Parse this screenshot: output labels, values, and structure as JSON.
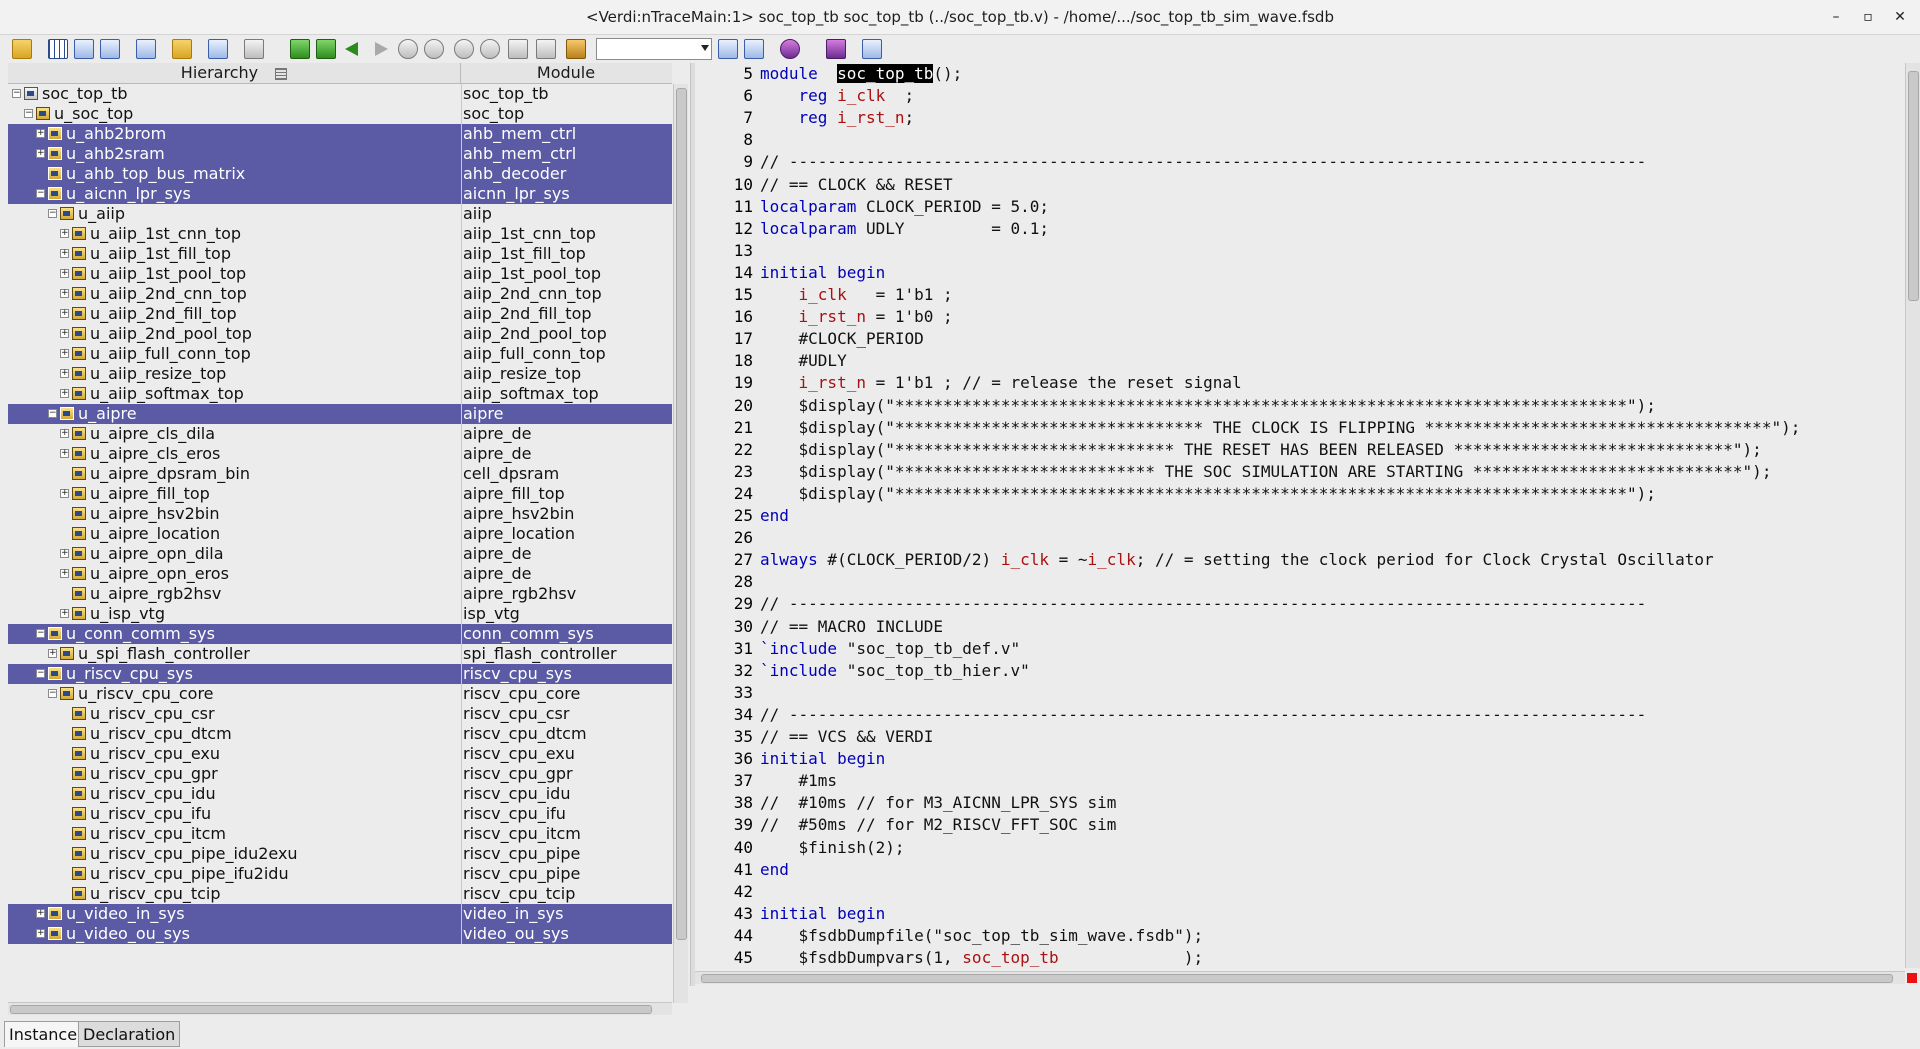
{
  "window": {
    "title": "<Verdi:nTraceMain:1> soc_top_tb soc_top_tb (../soc_top_tb.v) - /home/.../soc_top_tb_sim_wave.fsdb",
    "minimize": "–",
    "restore": "▫",
    "close": "✕"
  },
  "toolbar": {
    "combo_value": ""
  },
  "hierarchy": {
    "col_instance": "Hierarchy",
    "col_module": "Module",
    "rows": [
      {
        "name": "soc_top_tb",
        "module": "soc_top_tb",
        "level": 0,
        "expander": "-",
        "selected": false,
        "icon": "top"
      },
      {
        "name": "u_soc_top",
        "module": "soc_top",
        "level": 1,
        "expander": "-",
        "selected": false,
        "icon": "module"
      },
      {
        "name": "u_ahb2brom",
        "module": "ahb_mem_ctrl",
        "level": 2,
        "expander": "+",
        "selected": true,
        "icon": "module"
      },
      {
        "name": "u_ahb2sram",
        "module": "ahb_mem_ctrl",
        "level": 2,
        "expander": "+",
        "selected": true,
        "icon": "module"
      },
      {
        "name": "u_ahb_top_bus_matrix",
        "module": "ahb_decoder",
        "level": 2,
        "expander": "",
        "selected": true,
        "icon": "module"
      },
      {
        "name": "u_aicnn_lpr_sys",
        "module": "aicnn_lpr_sys",
        "level": 2,
        "expander": "-",
        "selected": true,
        "icon": "module"
      },
      {
        "name": "u_aiip",
        "module": "aiip",
        "level": 3,
        "expander": "-",
        "selected": false,
        "icon": "module"
      },
      {
        "name": "u_aiip_1st_cnn_top",
        "module": "aiip_1st_cnn_top",
        "level": 4,
        "expander": "+",
        "selected": false,
        "icon": "module"
      },
      {
        "name": "u_aiip_1st_fill_top",
        "module": "aiip_1st_fill_top",
        "level": 4,
        "expander": "+",
        "selected": false,
        "icon": "module"
      },
      {
        "name": "u_aiip_1st_pool_top",
        "module": "aiip_1st_pool_top",
        "level": 4,
        "expander": "+",
        "selected": false,
        "icon": "module"
      },
      {
        "name": "u_aiip_2nd_cnn_top",
        "module": "aiip_2nd_cnn_top",
        "level": 4,
        "expander": "+",
        "selected": false,
        "icon": "module"
      },
      {
        "name": "u_aiip_2nd_fill_top",
        "module": "aiip_2nd_fill_top",
        "level": 4,
        "expander": "+",
        "selected": false,
        "icon": "module"
      },
      {
        "name": "u_aiip_2nd_pool_top",
        "module": "aiip_2nd_pool_top",
        "level": 4,
        "expander": "+",
        "selected": false,
        "icon": "module"
      },
      {
        "name": "u_aiip_full_conn_top",
        "module": "aiip_full_conn_top",
        "level": 4,
        "expander": "+",
        "selected": false,
        "icon": "module"
      },
      {
        "name": "u_aiip_resize_top",
        "module": "aiip_resize_top",
        "level": 4,
        "expander": "+",
        "selected": false,
        "icon": "module"
      },
      {
        "name": "u_aiip_softmax_top",
        "module": "aiip_softmax_top",
        "level": 4,
        "expander": "+",
        "selected": false,
        "icon": "module"
      },
      {
        "name": "u_aipre",
        "module": "aipre",
        "level": 3,
        "expander": "-",
        "selected": true,
        "icon": "module"
      },
      {
        "name": "u_aipre_cls_dila",
        "module": "aipre_de",
        "level": 4,
        "expander": "+",
        "selected": false,
        "icon": "module"
      },
      {
        "name": "u_aipre_cls_eros",
        "module": "aipre_de",
        "level": 4,
        "expander": "+",
        "selected": false,
        "icon": "module"
      },
      {
        "name": "u_aipre_dpsram_bin",
        "module": "cell_dpsram",
        "level": 4,
        "expander": "",
        "selected": false,
        "icon": "module"
      },
      {
        "name": "u_aipre_fill_top",
        "module": "aipre_fill_top",
        "level": 4,
        "expander": "+",
        "selected": false,
        "icon": "module"
      },
      {
        "name": "u_aipre_hsv2bin",
        "module": "aipre_hsv2bin",
        "level": 4,
        "expander": "",
        "selected": false,
        "icon": "module"
      },
      {
        "name": "u_aipre_location",
        "module": "aipre_location",
        "level": 4,
        "expander": "",
        "selected": false,
        "icon": "module"
      },
      {
        "name": "u_aipre_opn_dila",
        "module": "aipre_de",
        "level": 4,
        "expander": "+",
        "selected": false,
        "icon": "module"
      },
      {
        "name": "u_aipre_opn_eros",
        "module": "aipre_de",
        "level": 4,
        "expander": "+",
        "selected": false,
        "icon": "module"
      },
      {
        "name": "u_aipre_rgb2hsv",
        "module": "aipre_rgb2hsv",
        "level": 4,
        "expander": "",
        "selected": false,
        "icon": "module"
      },
      {
        "name": "u_isp_vtg",
        "module": "isp_vtg",
        "level": 4,
        "expander": "+",
        "selected": false,
        "icon": "module"
      },
      {
        "name": "u_conn_comm_sys",
        "module": "conn_comm_sys",
        "level": 2,
        "expander": "-",
        "selected": true,
        "icon": "module"
      },
      {
        "name": "u_spi_flash_controller",
        "module": "spi_flash_controller",
        "level": 3,
        "expander": "+",
        "selected": false,
        "icon": "module"
      },
      {
        "name": "u_riscv_cpu_sys",
        "module": "riscv_cpu_sys",
        "level": 2,
        "expander": "-",
        "selected": true,
        "icon": "module"
      },
      {
        "name": "u_riscv_cpu_core",
        "module": "riscv_cpu_core",
        "level": 3,
        "expander": "-",
        "selected": false,
        "icon": "module"
      },
      {
        "name": "u_riscv_cpu_csr",
        "module": "riscv_cpu_csr",
        "level": 4,
        "expander": "",
        "selected": false,
        "icon": "module"
      },
      {
        "name": "u_riscv_cpu_dtcm",
        "module": "riscv_cpu_dtcm",
        "level": 4,
        "expander": "",
        "selected": false,
        "icon": "module"
      },
      {
        "name": "u_riscv_cpu_exu",
        "module": "riscv_cpu_exu",
        "level": 4,
        "expander": "",
        "selected": false,
        "icon": "module"
      },
      {
        "name": "u_riscv_cpu_gpr",
        "module": "riscv_cpu_gpr",
        "level": 4,
        "expander": "",
        "selected": false,
        "icon": "module"
      },
      {
        "name": "u_riscv_cpu_idu",
        "module": "riscv_cpu_idu",
        "level": 4,
        "expander": "",
        "selected": false,
        "icon": "module"
      },
      {
        "name": "u_riscv_cpu_ifu",
        "module": "riscv_cpu_ifu",
        "level": 4,
        "expander": "",
        "selected": false,
        "icon": "module"
      },
      {
        "name": "u_riscv_cpu_itcm",
        "module": "riscv_cpu_itcm",
        "level": 4,
        "expander": "",
        "selected": false,
        "icon": "module"
      },
      {
        "name": "u_riscv_cpu_pipe_idu2exu",
        "module": "riscv_cpu_pipe",
        "level": 4,
        "expander": "",
        "selected": false,
        "icon": "module"
      },
      {
        "name": "u_riscv_cpu_pipe_ifu2idu",
        "module": "riscv_cpu_pipe",
        "level": 4,
        "expander": "",
        "selected": false,
        "icon": "module"
      },
      {
        "name": "u_riscv_cpu_tcip",
        "module": "riscv_cpu_tcip",
        "level": 4,
        "expander": "",
        "selected": false,
        "icon": "module"
      },
      {
        "name": "u_video_in_sys",
        "module": "video_in_sys",
        "level": 2,
        "expander": "+",
        "selected": true,
        "icon": "module"
      },
      {
        "name": "u_video_ou_sys",
        "module": "video_ou_sys",
        "level": 2,
        "expander": "+",
        "selected": true,
        "icon": "module"
      }
    ]
  },
  "tabs": [
    {
      "label": "Instance",
      "active": true
    },
    {
      "label": "Declaration",
      "active": false
    }
  ],
  "source": {
    "lines": [
      {
        "n": "5",
        "segs": [
          [
            "kw",
            "module"
          ],
          [
            "",
            "  "
          ],
          [
            "hl",
            "soc_top_tb"
          ],
          [
            "",
            "();"
          ]
        ]
      },
      {
        "n": "6",
        "segs": [
          [
            "",
            "    "
          ],
          [
            "kw",
            "reg"
          ],
          [
            "",
            " "
          ],
          [
            "sig",
            "i_clk"
          ],
          [
            "",
            "  ;"
          ]
        ]
      },
      {
        "n": "7",
        "segs": [
          [
            "",
            "    "
          ],
          [
            "kw",
            "reg"
          ],
          [
            "",
            " "
          ],
          [
            "sig",
            "i_rst_n"
          ],
          [
            "",
            ";"
          ]
        ]
      },
      {
        "n": "8",
        "segs": []
      },
      {
        "n": "9",
        "segs": [
          [
            "",
            "// -----------------------------------------------------------------------------------------"
          ]
        ]
      },
      {
        "n": "10",
        "segs": [
          [
            "",
            "// == CLOCK && RESET"
          ]
        ]
      },
      {
        "n": "11",
        "segs": [
          [
            "kw",
            "localparam"
          ],
          [
            "",
            " CLOCK_PERIOD = 5.0;"
          ]
        ]
      },
      {
        "n": "12",
        "segs": [
          [
            "kw",
            "localparam"
          ],
          [
            "",
            " UDLY         = 0.1;"
          ]
        ]
      },
      {
        "n": "13",
        "segs": []
      },
      {
        "n": "14",
        "segs": [
          [
            "kw",
            "initial begin"
          ]
        ]
      },
      {
        "n": "15",
        "segs": [
          [
            "",
            "    "
          ],
          [
            "sig",
            "i_clk"
          ],
          [
            "",
            "   = 1'b1 ;"
          ]
        ]
      },
      {
        "n": "16",
        "segs": [
          [
            "",
            "    "
          ],
          [
            "sig",
            "i_rst_n"
          ],
          [
            "",
            " = 1'b0 ;"
          ]
        ]
      },
      {
        "n": "17",
        "segs": [
          [
            "",
            "    #CLOCK_PERIOD"
          ]
        ]
      },
      {
        "n": "18",
        "segs": [
          [
            "",
            "    #UDLY"
          ]
        ]
      },
      {
        "n": "19",
        "segs": [
          [
            "",
            "    "
          ],
          [
            "sig",
            "i_rst_n"
          ],
          [
            "",
            " = 1'b1 ; // = release the reset signal"
          ]
        ]
      },
      {
        "n": "20",
        "segs": [
          [
            "",
            "    $display(\"****************************************************************************\");"
          ]
        ]
      },
      {
        "n": "21",
        "segs": [
          [
            "",
            "    $display(\"******************************** THE CLOCK IS FLIPPING ************************************\");"
          ]
        ]
      },
      {
        "n": "22",
        "segs": [
          [
            "",
            "    $display(\"***************************** THE RESET HAS BEEN RELEASED *****************************\");"
          ]
        ]
      },
      {
        "n": "23",
        "segs": [
          [
            "",
            "    $display(\"*************************** THE SOC SIMULATION ARE STARTING ****************************\");"
          ]
        ]
      },
      {
        "n": "24",
        "segs": [
          [
            "",
            "    $display(\"****************************************************************************\");"
          ]
        ]
      },
      {
        "n": "25",
        "segs": [
          [
            "kw",
            "end"
          ]
        ]
      },
      {
        "n": "26",
        "segs": []
      },
      {
        "n": "27",
        "segs": [
          [
            "kw",
            "always"
          ],
          [
            "",
            " #(CLOCK_PERIOD/2) "
          ],
          [
            "sig",
            "i_clk"
          ],
          [
            "",
            " = ~"
          ],
          [
            "sig",
            "i_clk"
          ],
          [
            "",
            "; // = setting the clock period for Clock Crystal Oscillator"
          ]
        ]
      },
      {
        "n": "28",
        "segs": []
      },
      {
        "n": "29",
        "segs": [
          [
            "",
            "// -----------------------------------------------------------------------------------------"
          ]
        ]
      },
      {
        "n": "30",
        "segs": [
          [
            "",
            "// == MACRO INCLUDE"
          ]
        ]
      },
      {
        "n": "31",
        "segs": [
          [
            "kw",
            "`include"
          ],
          [
            "",
            " \"soc_top_tb_def.v\""
          ]
        ]
      },
      {
        "n": "32",
        "segs": [
          [
            "kw",
            "`include"
          ],
          [
            "",
            " \"soc_top_tb_hier.v\""
          ]
        ]
      },
      {
        "n": "33",
        "segs": []
      },
      {
        "n": "34",
        "segs": [
          [
            "",
            "// -----------------------------------------------------------------------------------------"
          ]
        ]
      },
      {
        "n": "35",
        "segs": [
          [
            "",
            "// == VCS && VERDI"
          ]
        ]
      },
      {
        "n": "36",
        "segs": [
          [
            "kw",
            "initial begin"
          ]
        ]
      },
      {
        "n": "37",
        "segs": [
          [
            "",
            "    #1ms"
          ]
        ]
      },
      {
        "n": "38",
        "segs": [
          [
            "",
            "//  #10ms // for M3_AICNN_LPR_SYS sim"
          ]
        ]
      },
      {
        "n": "39",
        "segs": [
          [
            "",
            "//  #50ms // for M2_RISCV_FFT_SOC sim"
          ]
        ]
      },
      {
        "n": "40",
        "segs": [
          [
            "",
            "    $finish(2);"
          ]
        ]
      },
      {
        "n": "41",
        "segs": [
          [
            "kw",
            "end"
          ]
        ]
      },
      {
        "n": "42",
        "segs": []
      },
      {
        "n": "43",
        "segs": [
          [
            "kw",
            "initial begin"
          ]
        ]
      },
      {
        "n": "44",
        "segs": [
          [
            "",
            "    $fsdbDumpfile(\"soc_top_tb_sim_wave.fsdb\");"
          ]
        ]
      },
      {
        "n": "45",
        "segs": [
          [
            "",
            "    $fsdbDumpvars(1, "
          ],
          [
            "sig",
            "soc_top_tb"
          ],
          [
            "",
            "             );"
          ]
        ]
      }
    ]
  },
  "icons": {
    "toolbar": [
      "open-folder-icon",
      "signal-list-icon",
      "schematic-icon",
      "hierarchy-tree-icon",
      "new-window-icon",
      "folder-icon",
      "edit-icon",
      "sheet-icon",
      "find-start-icon",
      "find-end-icon",
      "back-arrow-icon",
      "forward-arrow-icon",
      "find-driver-icon",
      "find-load-icon",
      "up-arrow-icon",
      "down-arrow-icon",
      "trace-icon",
      "show-scope-icon",
      "memory-icon",
      "zoom-fit-icon",
      "zoom-icon",
      "verdi-icon",
      "wave-icon",
      "settings-icon"
    ]
  }
}
